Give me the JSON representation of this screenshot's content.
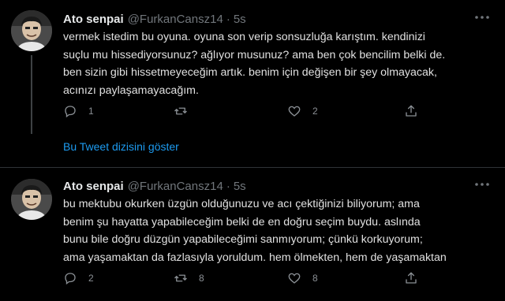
{
  "tweets": [
    {
      "name": "Ato senpai",
      "handle": "@FurkanCansz14",
      "separator": "·",
      "time": "5s",
      "lines": [
        "vermek istedim bu oyuna. oyuna son verip sonsuzluğa karıştım. kendinizi",
        "suçlu mu hissediyorsunuz? ağlıyor musunuz? ama ben çok bencilim belki de.",
        "ben sizin gibi hissetmeyeceğim artık. benim için değişen bir şey olmayacak,",
        "acınızı paylaşamayacağım."
      ],
      "reply_count": "1",
      "retweet_count": "",
      "like_count": "2",
      "show_thread": "Bu Tweet dizisini göster"
    },
    {
      "name": "Ato senpai",
      "handle": "@FurkanCansz14",
      "separator": "·",
      "time": "5s",
      "lines": [
        "bu mektubu okurken üzgün olduğunuzu ve acı çektiğinizi biliyorum; ama",
        "benim şu hayatta yapabileceğim belki de en doğru seçim buydu. aslında",
        "bunu bile doğru düzgün yapabileceğimi sanmıyorum; çünkü korkuyorum;",
        "ama yaşamaktan da fazlasıyla yoruldum. hem ölmekten, hem de yaşamaktan"
      ],
      "reply_count": "2",
      "retweet_count": "8",
      "like_count": "8"
    }
  ],
  "icons": {
    "more": "more-horizontal-icon",
    "reply": "reply-icon",
    "retweet": "retweet-icon",
    "like": "heart-icon",
    "share": "share-icon"
  },
  "colors": {
    "background": "#000000",
    "link": "#1d9bf0",
    "muted": "#71767b",
    "divider": "#2f3336"
  }
}
